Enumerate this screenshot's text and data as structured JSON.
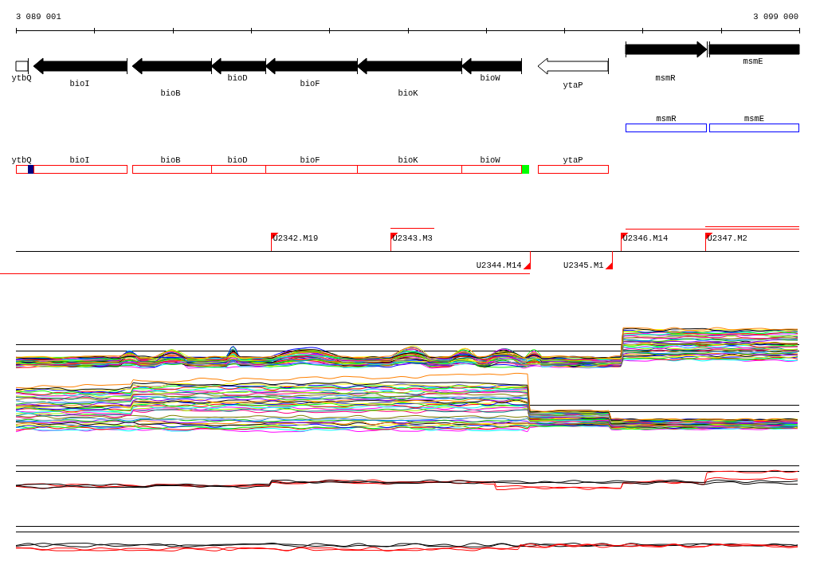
{
  "ruler": {
    "start_label": "3 089 001",
    "end_label": "3 099 000"
  },
  "gene_track": [
    {
      "label": "ytbQ",
      "kind": "block",
      "filled": false
    },
    {
      "label": "bioI",
      "kind": "reverse",
      "filled": true
    },
    {
      "label": "bioB",
      "kind": "reverse",
      "filled": true
    },
    {
      "label": "bioD",
      "kind": "reverse",
      "filled": true
    },
    {
      "label": "bioF",
      "kind": "reverse",
      "filled": true
    },
    {
      "label": "bioK",
      "kind": "reverse",
      "filled": true
    },
    {
      "label": "bioW",
      "kind": "reverse",
      "filled": true
    },
    {
      "label": "ytaP",
      "kind": "reverse",
      "filled": false
    },
    {
      "label": "msmR",
      "kind": "forward",
      "filled": true
    },
    {
      "label": "msmE",
      "kind": "block",
      "filled": true
    }
  ],
  "blue_track": [
    {
      "label": "msmR"
    },
    {
      "label": "msmE"
    }
  ],
  "red_track": [
    {
      "label": "ytbQ"
    },
    {
      "label": "bioI"
    },
    {
      "label": "bioB"
    },
    {
      "label": "bioD"
    },
    {
      "label": "bioF"
    },
    {
      "label": "bioK"
    },
    {
      "label": "bioW"
    },
    {
      "label": "ytaP"
    }
  ],
  "red_track_markers": [
    {
      "color": "#000080"
    },
    {
      "color": "#00ff00"
    }
  ],
  "transcription_units": [
    {
      "label": "U2342.M19",
      "kind": "forward"
    },
    {
      "label": "U2343.M3",
      "kind": "forward"
    },
    {
      "label": "U2344.M14",
      "kind": "reverse"
    },
    {
      "label": "U2345.M1",
      "kind": "reverse"
    },
    {
      "label": "U2346.M14",
      "kind": "forward"
    },
    {
      "label": "U2347.M2",
      "kind": "forward"
    }
  ]
}
